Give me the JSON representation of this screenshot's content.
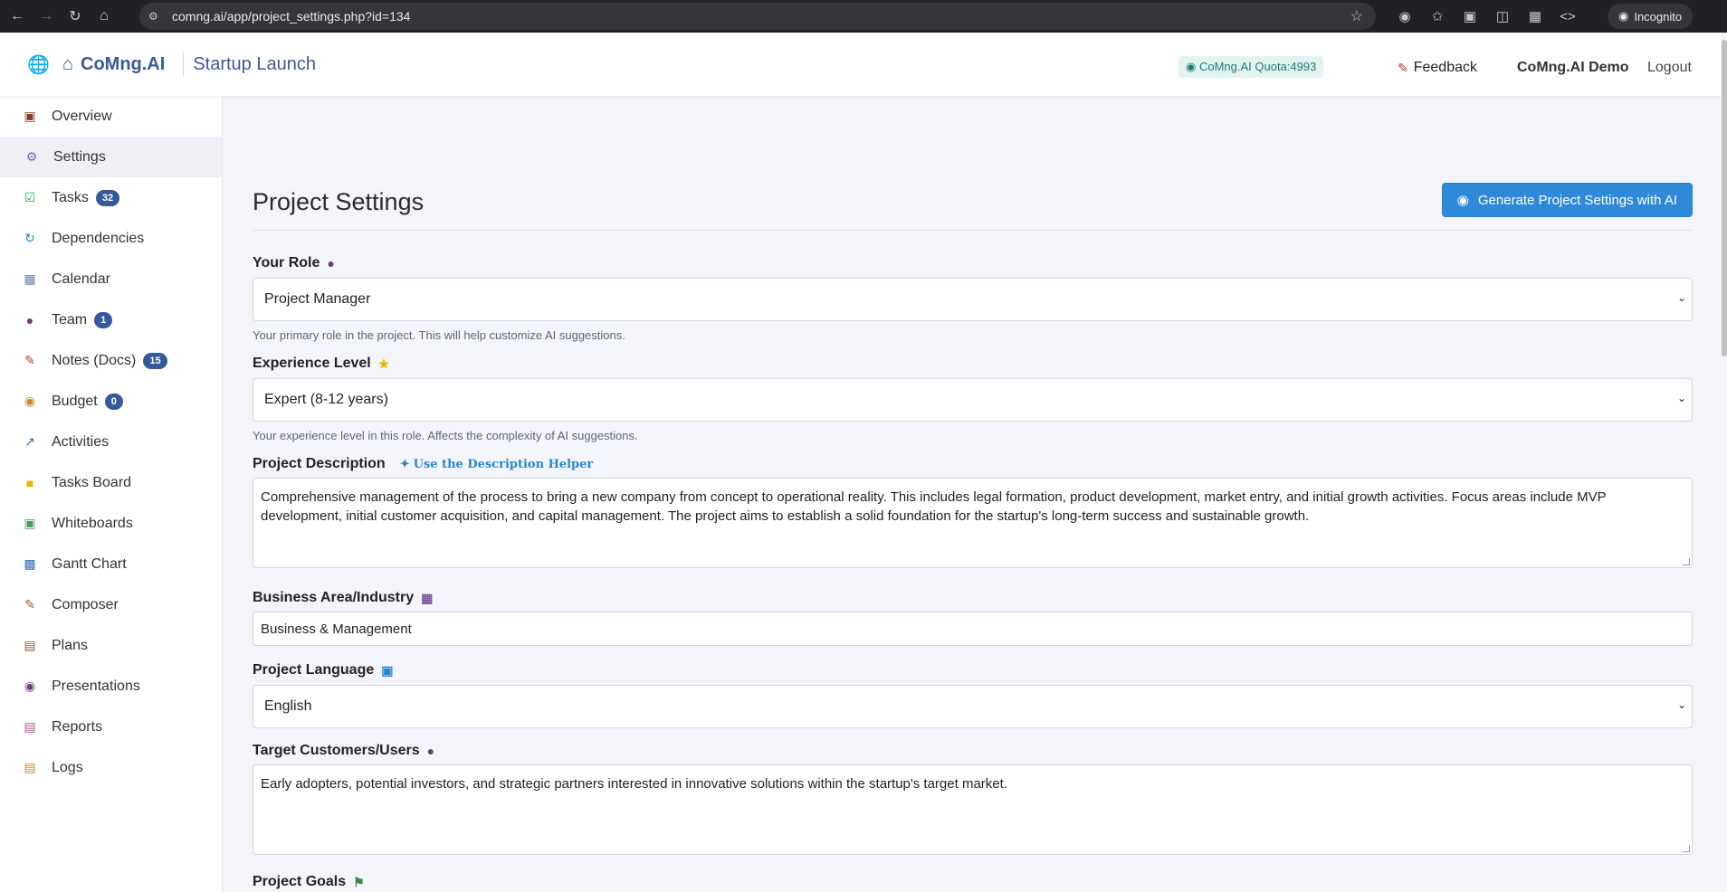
{
  "browser": {
    "url": "comng.ai/app/project_settings.php?id=134",
    "incognito_label": "Incognito"
  },
  "header": {
    "brand": "CoMng.AI",
    "project_name": "Startup Launch",
    "quota": "CoMng.AI Quota:4993",
    "feedback": "Feedback",
    "user": "CoMng.AI Demo",
    "logout": "Logout"
  },
  "sidebar": {
    "items": [
      {
        "label": "Overview",
        "icon": "briefcase-icon",
        "badge": ""
      },
      {
        "label": "Settings",
        "icon": "gear-icon",
        "badge": ""
      },
      {
        "label": "Tasks",
        "icon": "checkbox-icon",
        "badge": "32"
      },
      {
        "label": "Dependencies",
        "icon": "refresh-icon",
        "badge": ""
      },
      {
        "label": "Calendar",
        "icon": "calendar-icon",
        "badge": ""
      },
      {
        "label": "Team",
        "icon": "people-icon",
        "badge": "1"
      },
      {
        "label": "Notes (Docs)",
        "icon": "memo-icon",
        "badge": "15"
      },
      {
        "label": "Budget",
        "icon": "money-bag-icon",
        "badge": "0"
      },
      {
        "label": "Activities",
        "icon": "chart-up-icon",
        "badge": ""
      },
      {
        "label": "Tasks Board",
        "icon": "sticky-note-icon",
        "badge": ""
      },
      {
        "label": "Whiteboards",
        "icon": "picture-icon",
        "badge": ""
      },
      {
        "label": "Gantt Chart",
        "icon": "bar-chart-icon",
        "badge": ""
      },
      {
        "label": "Composer",
        "icon": "pencil-paper-icon",
        "badge": ""
      },
      {
        "label": "Plans",
        "icon": "clipboard-icon",
        "badge": ""
      },
      {
        "label": "Presentations",
        "icon": "camera-icon",
        "badge": ""
      },
      {
        "label": "Reports",
        "icon": "report-icon",
        "badge": ""
      },
      {
        "label": "Logs",
        "icon": "scroll-icon",
        "badge": ""
      }
    ]
  },
  "main": {
    "title": "Project Settings",
    "generate_button": "Generate Project Settings with AI",
    "role": {
      "label": "Your Role",
      "value": "Project Manager",
      "hint": "Your primary role in the project. This will help customize AI suggestions."
    },
    "experience": {
      "label": "Experience Level",
      "value": "Expert (8-12 years)",
      "hint": "Your experience level in this role. Affects the complexity of AI suggestions."
    },
    "description": {
      "label": "Project Description",
      "helper": "Use the Description Helper",
      "value": "Comprehensive management of the process to bring a new company from concept to operational reality. This includes legal formation, product development, market entry, and initial growth activities. Focus areas include MVP development, initial customer acquisition, and capital management. The project aims to establish a solid foundation for the startup's long-term success and sustainable growth."
    },
    "industry": {
      "label": "Business Area/Industry",
      "value": "Business & Management"
    },
    "language": {
      "label": "Project Language",
      "value": "English"
    },
    "customers": {
      "label": "Target Customers/Users",
      "value": "Early adopters, potential investors, and strategic partners interested in innovative solutions within the startup's target market."
    },
    "goals": {
      "label": "Project Goals"
    }
  }
}
